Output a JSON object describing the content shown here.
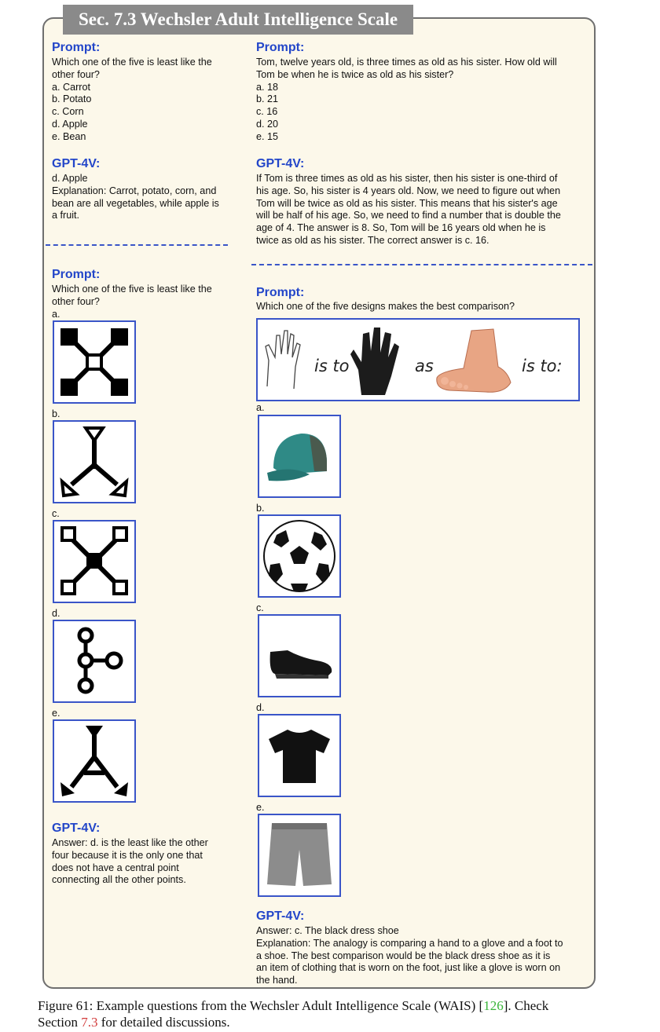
{
  "header": {
    "title": "Sec. 7.3 Wechsler Adult Intelligence Scale"
  },
  "q1": {
    "prompt_heading": "Prompt:",
    "prompt_lines": [
      "Which one of the five is least like the",
      "other four?",
      "a. Carrot",
      "b. Potato",
      "c. Corn",
      "d. Apple",
      "e. Bean"
    ],
    "answer_heading": "GPT-4V:",
    "answer_lines": [
      "d. Apple",
      "Explanation: Carrot, potato, corn, and",
      "bean are all vegetables, while apple is",
      "a fruit."
    ]
  },
  "q2": {
    "prompt_heading": "Prompt:",
    "prompt_lines": [
      "Tom, twelve years old, is three times as old as his sister. How old will",
      "Tom be when he is twice as old as his sister?",
      "a. 18",
      "b. 21",
      "c. 16",
      "d. 20",
      "e. 15"
    ],
    "answer_heading": "GPT-4V:",
    "answer_lines": [
      "If Tom is three times as old as his sister, then his sister is one-third of",
      "his age. So, his sister is 4 years old. Now, we need to figure out when",
      "Tom will be twice as old as his sister. This means that his sister's age",
      "will be half of his age. So, we need to find a number that is double the",
      "age of 4. The answer is 8. So, Tom will be 16 years old when he is",
      "twice as old as his sister. The correct answer is c. 16."
    ]
  },
  "q3": {
    "prompt_heading": "Prompt:",
    "prompt_lines": [
      "Which one of the five is least like the",
      "other four?"
    ],
    "option_labels": [
      "a.",
      "b.",
      "c.",
      "d.",
      "e."
    ],
    "answer_heading": "GPT-4V:",
    "answer_lines": [
      "Answer: d.  is the least like the other",
      "four because it is the only one that",
      "does not have a central point",
      "connecting all the other points."
    ]
  },
  "q4": {
    "prompt_heading": "Prompt:",
    "prompt_lines": [
      "Which one of the five designs makes the best comparison?"
    ],
    "analogy_words": [
      "is to",
      "as",
      "is to:"
    ],
    "option_labels": [
      "a.",
      "b.",
      "c.",
      "d.",
      "e."
    ],
    "answer_heading": "GPT-4V:",
    "answer_lines": [
      "Answer: c. The black dress shoe",
      "Explanation: The analogy is comparing a hand to a glove and a foot to",
      "a shoe. The best comparison would be the black dress shoe as it is",
      "an item of clothing that is worn on the foot, just like a glove is worn on",
      "the hand."
    ]
  },
  "caption": {
    "prefix": "Figure 61: Example questions from the Wechsler Adult Intelligence Scale (WAIS) [",
    "ref": "126",
    "middle": "].  Check",
    "line2_prefix": "Section ",
    "section_ref": "7.3",
    "suffix": " for detailed discussions."
  },
  "colors": {
    "heading": "#2346c9",
    "box_border": "#3a55c8",
    "panel_bg": "#fcf8ea"
  }
}
